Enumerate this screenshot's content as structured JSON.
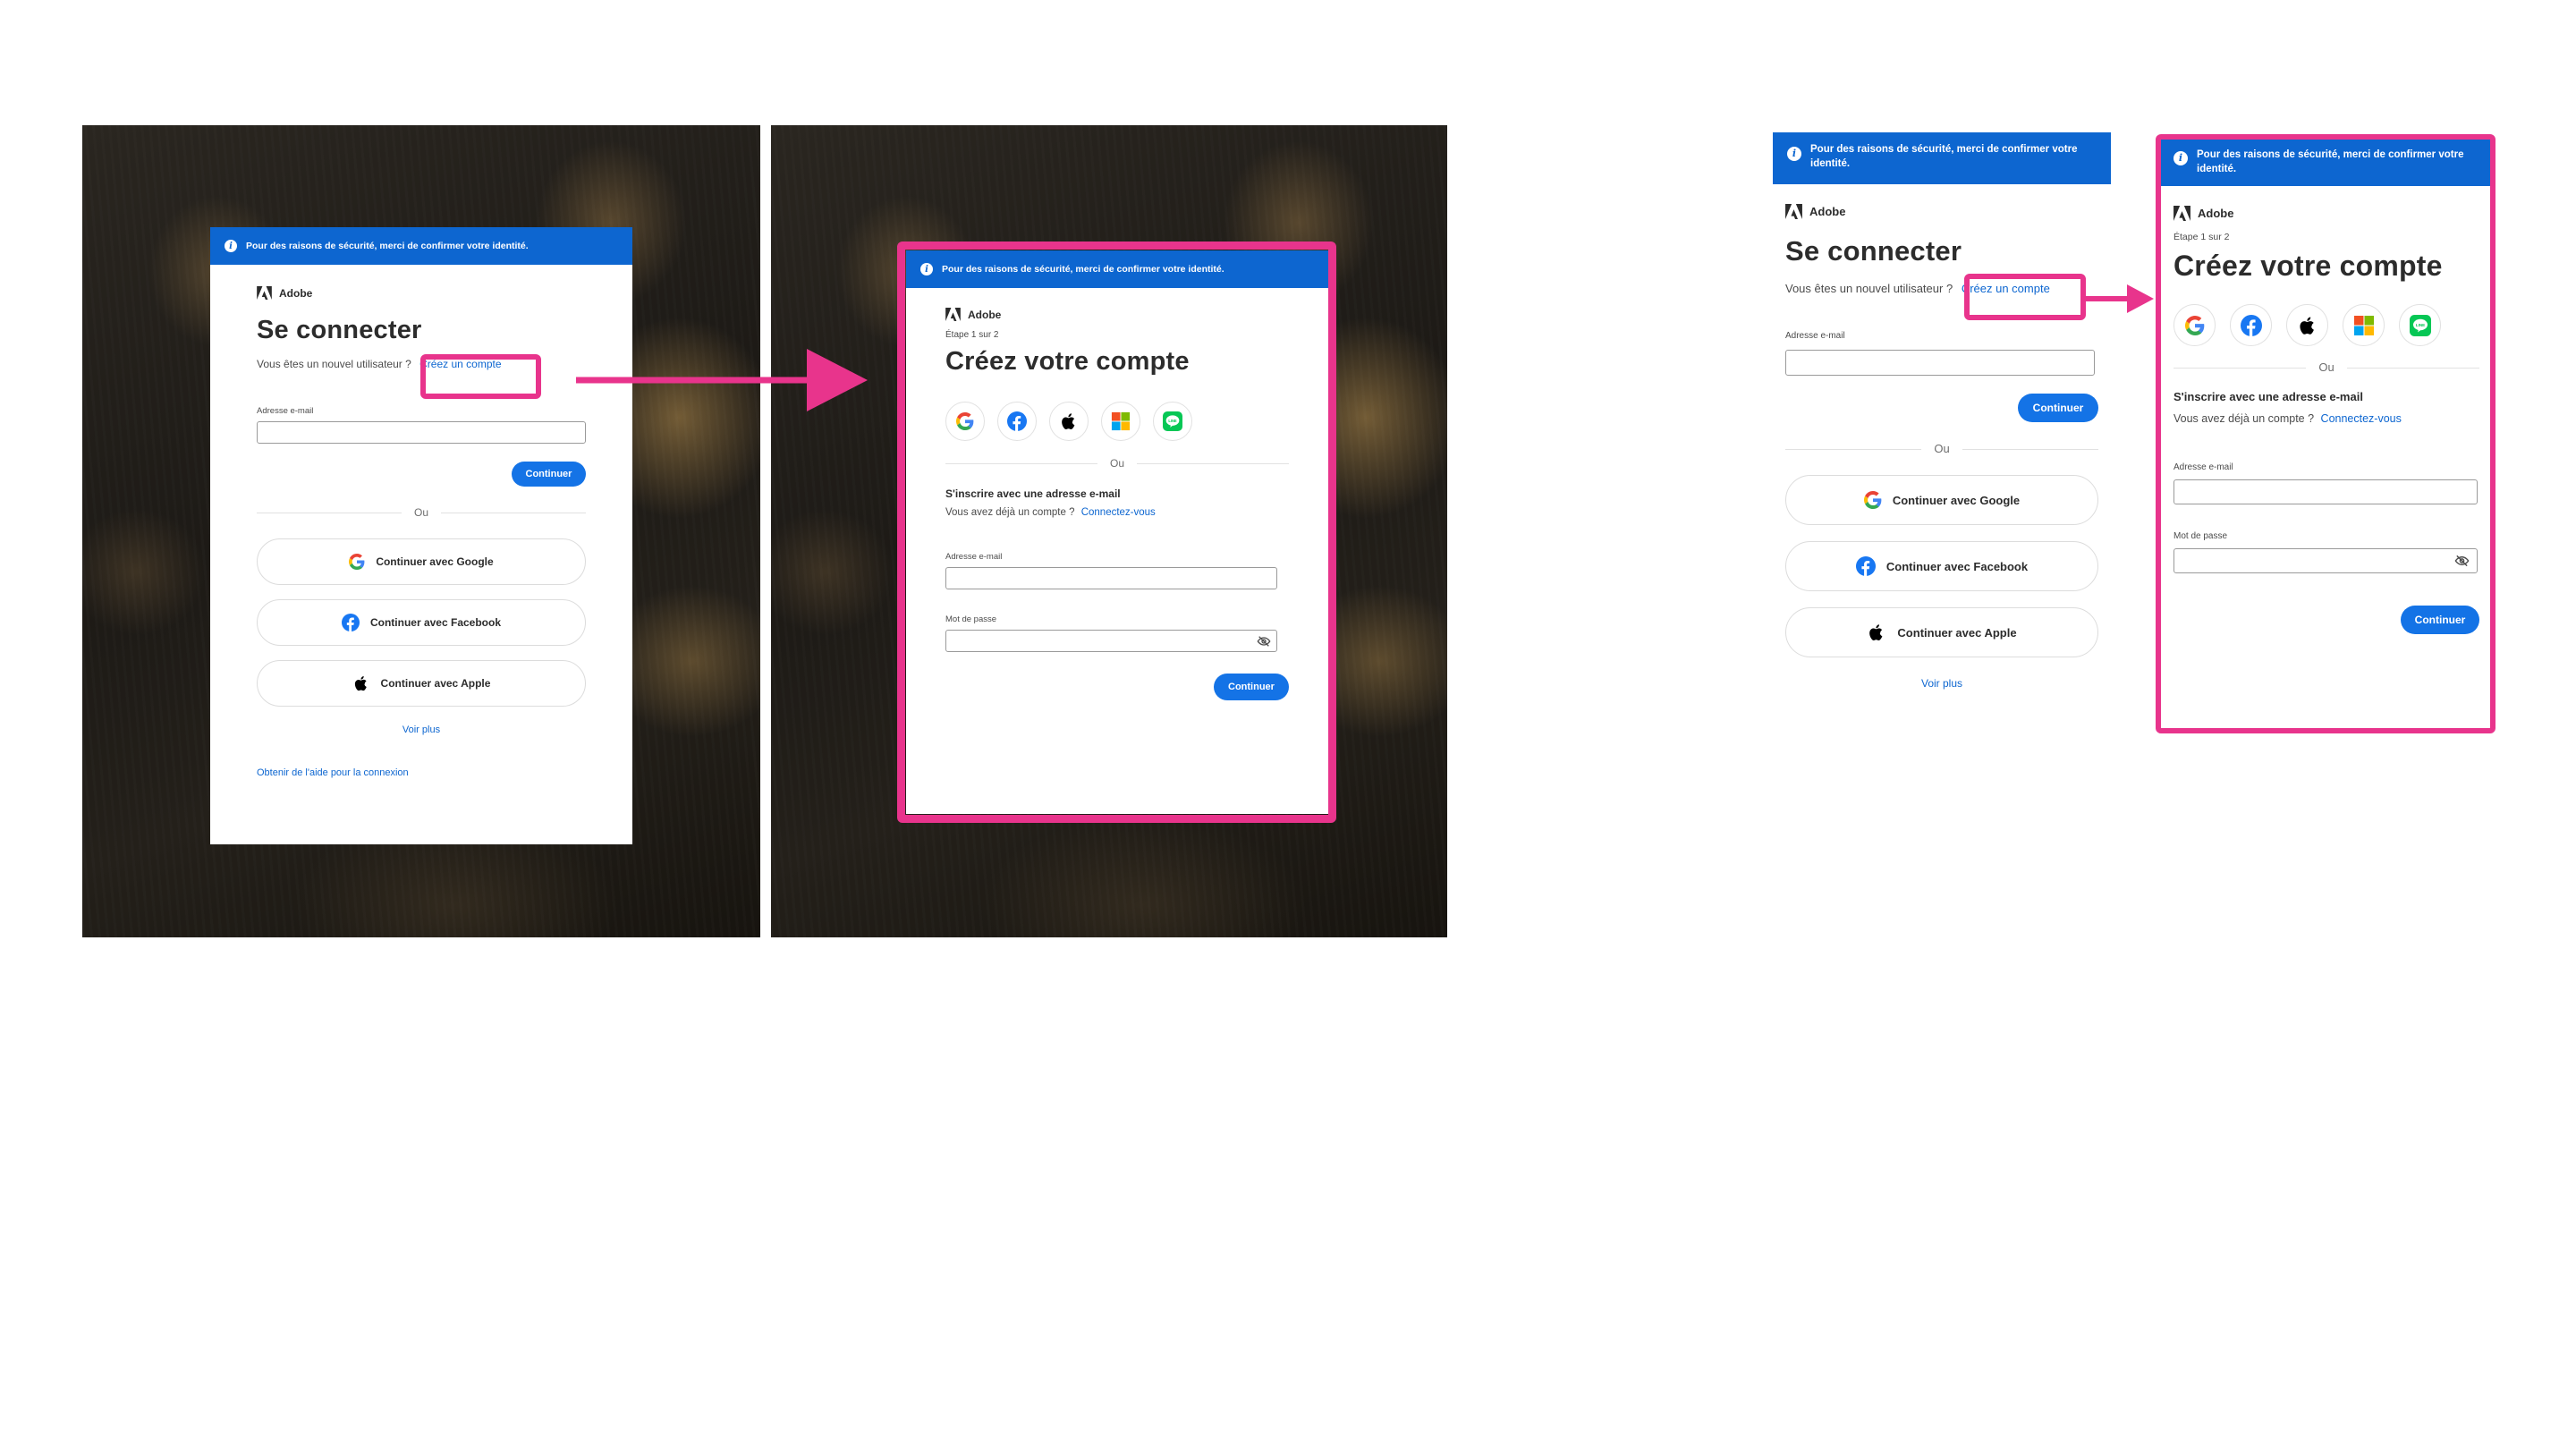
{
  "banner": {
    "text": "Pour des raisons de sécurité, merci de confirmer votre identité."
  },
  "brand": {
    "name": "Adobe"
  },
  "signin": {
    "title": "Se connecter",
    "new_user_text": "Vous êtes un nouvel utilisateur ?",
    "create_account_link": "Créez un compte",
    "email_label": "Adresse e-mail",
    "continue_label": "Continuer",
    "or_label": "Ou",
    "google_label": "Continuer avec Google",
    "facebook_label": "Continuer avec Facebook",
    "apple_label": "Continuer avec Apple",
    "more_label": "Voir plus",
    "help_link": "Obtenir de l'aide pour la connexion"
  },
  "signup": {
    "step": "Étape 1 sur 2",
    "title": "Créez votre compte",
    "or_label": "Ou",
    "email_heading": "S'inscrire avec une adresse e-mail",
    "have_account_text": "Vous avez déjà un compte ?",
    "signin_link": "Connectez-vous",
    "email_label": "Adresse e-mail",
    "password_label": "Mot de passe",
    "continue_label": "Continuer"
  },
  "social_icons": [
    "google-icon",
    "facebook-icon",
    "apple-icon",
    "microsoft-icon",
    "line-icon"
  ],
  "colors": {
    "accent": "#0d66d0",
    "button": "#1473e6",
    "highlight": "#e8348c"
  }
}
